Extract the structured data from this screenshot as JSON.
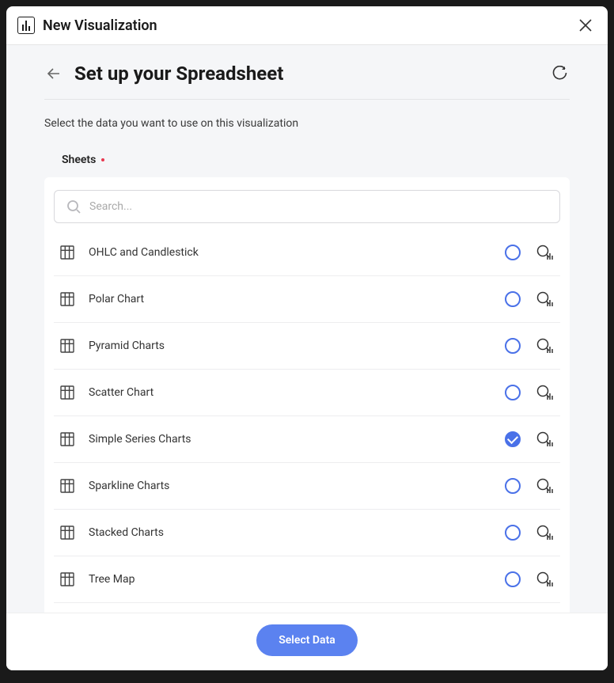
{
  "window": {
    "title": "New Visualization"
  },
  "page": {
    "title": "Set up your Spreadsheet",
    "subtitle": "Select the data you want to use on this visualization"
  },
  "section": {
    "label": "Sheets"
  },
  "search": {
    "placeholder": "Search..."
  },
  "sheets": [
    {
      "label": "OHLC and Candlestick",
      "selected": false
    },
    {
      "label": "Polar Chart",
      "selected": false
    },
    {
      "label": "Pyramid Charts",
      "selected": false
    },
    {
      "label": "Scatter Chart",
      "selected": false
    },
    {
      "label": "Simple Series Charts",
      "selected": true
    },
    {
      "label": "Sparkline Charts",
      "selected": false
    },
    {
      "label": "Stacked Charts",
      "selected": false
    },
    {
      "label": "Tree Map",
      "selected": false
    }
  ],
  "footer": {
    "primary_button": "Select Data"
  }
}
